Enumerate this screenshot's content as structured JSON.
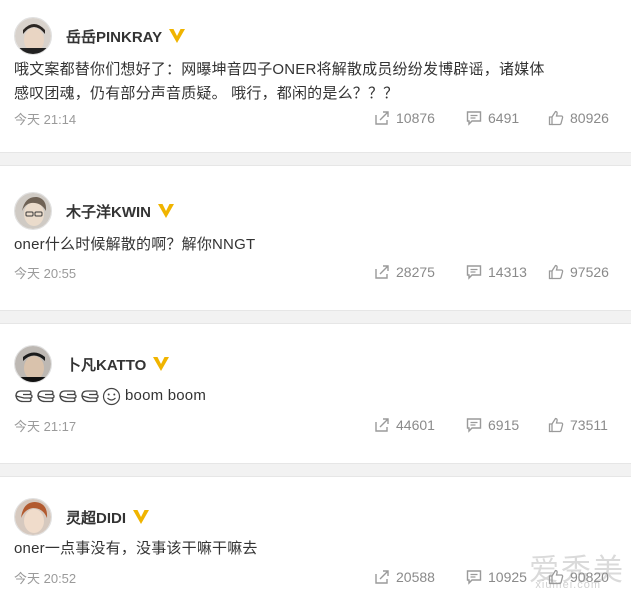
{
  "colors": {
    "accent_verified": "#f0b400",
    "text_primary": "#333333",
    "text_muted": "#9a9a9a",
    "divider": "#f2f2f2"
  },
  "icons": {
    "repost": "share-icon",
    "comment": "comment-icon",
    "like": "thumbs-up-icon",
    "verified": "verified-v-icon"
  },
  "posts": [
    {
      "username": "岳岳PINKRAY",
      "content_lines": [
        "哦文案都替你们想好了：网曝坤音四子ONER将解散成员纷纷发博辟谣，诸媒体",
        "感叹团魂，仍有部分声音质疑。  哦行，都闲的是么？？？"
      ],
      "timestamp": "今天 21:14",
      "reposts": "10876",
      "comments": "6491",
      "likes": "80926"
    },
    {
      "username": "木子洋KWIN",
      "content_lines": [
        "oner什么时候解散的啊？解你NNGT"
      ],
      "timestamp": "今天 20:55",
      "reposts": "28275",
      "comments": "14313",
      "likes": "97526"
    },
    {
      "username": "卜凡KATTO",
      "content_text": "boom boom",
      "content_emojis": [
        "hand-emoji",
        "hand-emoji",
        "hand-emoji",
        "hand-emoji",
        "smile-emoji"
      ],
      "timestamp": "今天 21:17",
      "reposts": "44601",
      "comments": "6915",
      "likes": "73511"
    },
    {
      "username": "灵超DIDI",
      "content_lines": [
        "oner一点事没有，没事该干嘛干嘛去"
      ],
      "timestamp": "今天 20:52",
      "reposts": "20588",
      "comments": "10925",
      "likes": "90820"
    }
  ],
  "watermark": {
    "text": "爱秀美",
    "sub": "xiumei.com"
  }
}
